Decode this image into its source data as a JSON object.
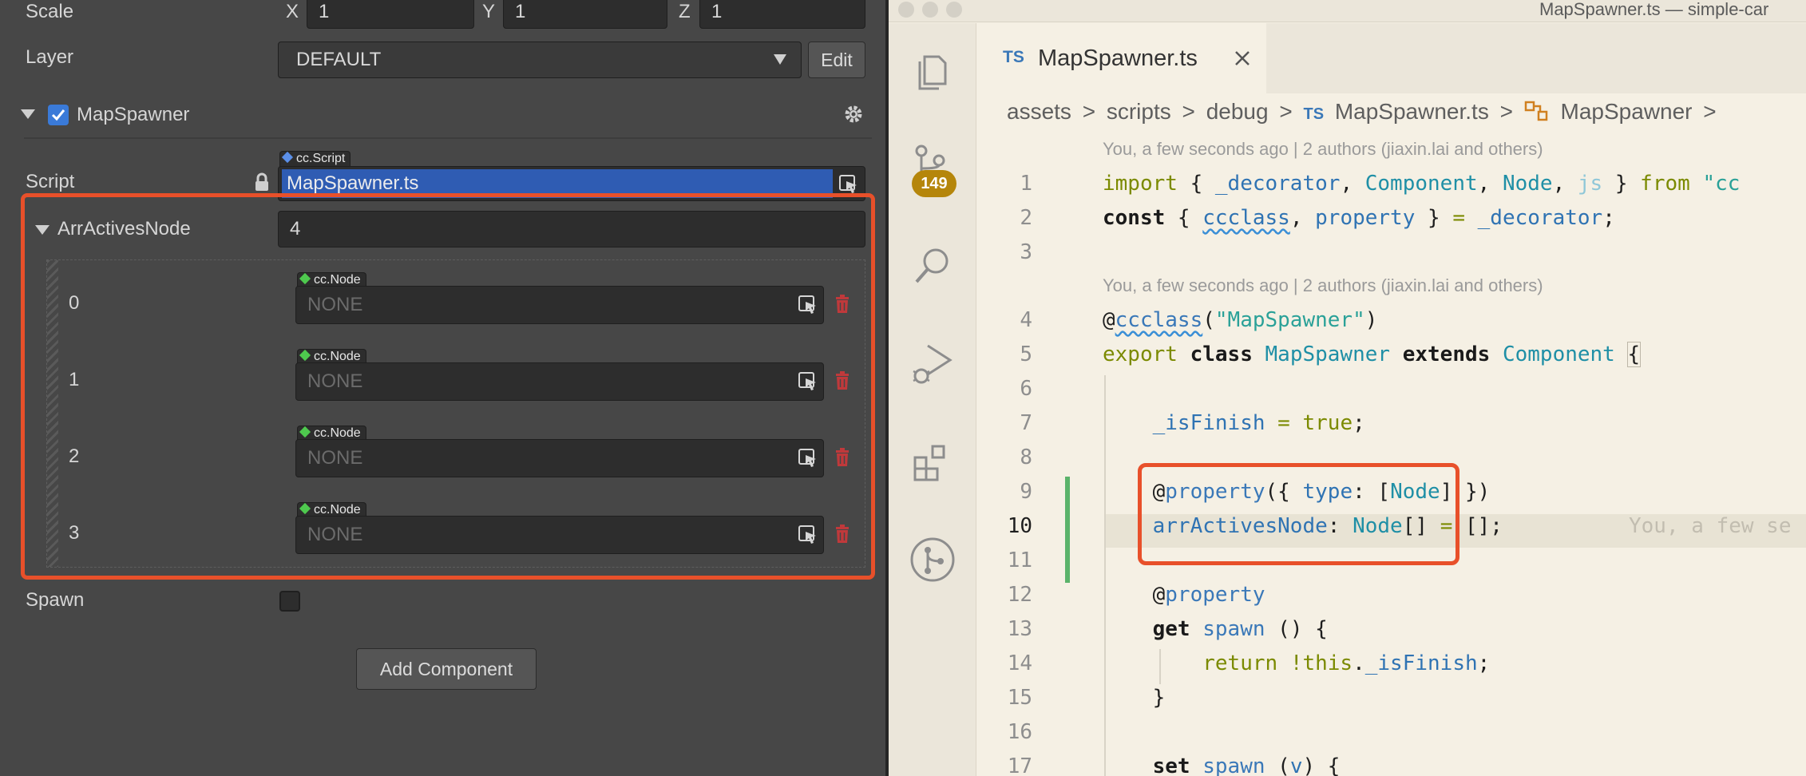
{
  "inspector": {
    "scale": {
      "label": "Scale",
      "x_label": "X",
      "x": "1",
      "y_label": "Y",
      "y": "1",
      "z_label": "Z",
      "z": "1"
    },
    "layer": {
      "label": "Layer",
      "value": "DEFAULT",
      "edit_label": "Edit"
    },
    "component": {
      "name": "MapSpawner",
      "enabled": true
    },
    "script": {
      "label": "Script",
      "type_tag": "cc.Script",
      "value": "MapSpawner.ts"
    },
    "arr": {
      "label": "ArrActivesNode",
      "count": "4",
      "items": [
        {
          "index": "0",
          "type_tag": "cc.Node",
          "value": "NONE"
        },
        {
          "index": "1",
          "type_tag": "cc.Node",
          "value": "NONE"
        },
        {
          "index": "2",
          "type_tag": "cc.Node",
          "value": "NONE"
        },
        {
          "index": "3",
          "type_tag": "cc.Node",
          "value": "NONE"
        }
      ]
    },
    "spawn": {
      "label": "Spawn",
      "checked": false
    },
    "add_component_label": "Add Component"
  },
  "editor": {
    "window_title": "MapSpawner.ts — simple-car",
    "tab": {
      "badge": "TS",
      "name": "MapSpawner.ts"
    },
    "breadcrumb": [
      "assets",
      "scripts",
      "debug",
      "MapSpawner.ts",
      "MapSpawner"
    ],
    "breadcrumb_file_badge": "TS",
    "scm_badge": "149",
    "codelens": "You, a few seconds ago | 2 authors (jiaxin.lai and others)",
    "inline_blame": "You, a few se",
    "line_numbers": [
      "1",
      "2",
      "3",
      "4",
      "5",
      "6",
      "7",
      "8",
      "9",
      "10",
      "11",
      "12",
      "13",
      "14",
      "15",
      "16",
      "17"
    ]
  },
  "colors": {
    "highlight_border": "#e8502a",
    "selection_blue": "#2f5cb3",
    "checkbox_blue": "#3a7ad8",
    "trash_red": "#c0393b",
    "git_added": "#5bb36a",
    "badge_gold": "#b5860b"
  },
  "icons": [
    "explorer-icon",
    "source-control-icon",
    "search-icon",
    "run-debug-icon",
    "extensions-icon",
    "git-graph-icon",
    "gear-icon",
    "lock-icon",
    "node-picker-icon",
    "trash-icon",
    "close-icon",
    "class-icon"
  ]
}
